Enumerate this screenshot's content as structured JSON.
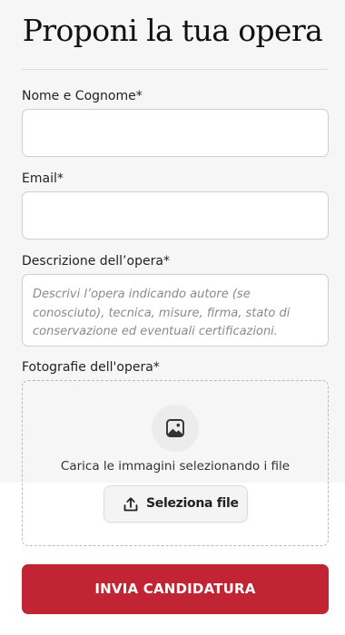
{
  "page": {
    "title": "Proponi la tua opera"
  },
  "form": {
    "name_label": "Nome e Cognome*",
    "email_label": "Email*",
    "description_label": "Descrizione dell’opera*",
    "description_placeholder": "Descrivi l’opera indicando autore (se conosciuto), tecnica, misure, firma, stato di conservazione ed eventuali certificazioni.",
    "photos_label": "Fotografie dell'opera*",
    "upload_text": "Carica le immagini selezionando i file",
    "select_button": "Seleziona file",
    "submit_button": "INVIA CANDIDATURA"
  },
  "icons": {
    "image": "image-icon",
    "upload": "upload-icon"
  },
  "colors": {
    "accent": "#c12433",
    "panel_background": "#f6f6f6"
  }
}
